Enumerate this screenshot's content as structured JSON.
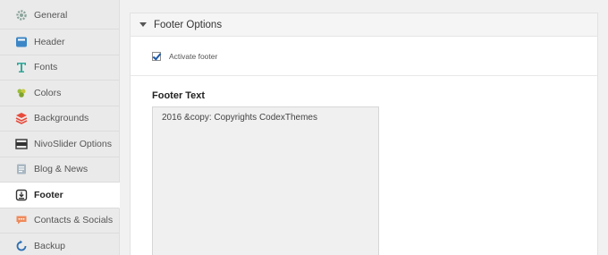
{
  "sidebar": {
    "items": [
      {
        "label": "General",
        "icon": "gear-icon"
      },
      {
        "label": "Header",
        "icon": "header-icon"
      },
      {
        "label": "Fonts",
        "icon": "font-icon"
      },
      {
        "label": "Colors",
        "icon": "palette-icon"
      },
      {
        "label": "Backgrounds",
        "icon": "layers-icon"
      },
      {
        "label": "NivoSlider Options",
        "icon": "slider-icon"
      },
      {
        "label": "Blog & News",
        "icon": "blog-icon"
      },
      {
        "label": "Footer",
        "icon": "footer-icon",
        "active": true
      },
      {
        "label": "Contacts & Socials",
        "icon": "chat-icon"
      },
      {
        "label": "Backup",
        "icon": "backup-icon"
      }
    ]
  },
  "panel": {
    "title": "Footer Options",
    "activate_label": "Activate footer",
    "activate_checked": true,
    "footer_text_title": "Footer Text",
    "footer_text_value": "2016 &copy: Copyrights CodexThemes"
  },
  "colors": {
    "accent": "#1e5aa8"
  }
}
